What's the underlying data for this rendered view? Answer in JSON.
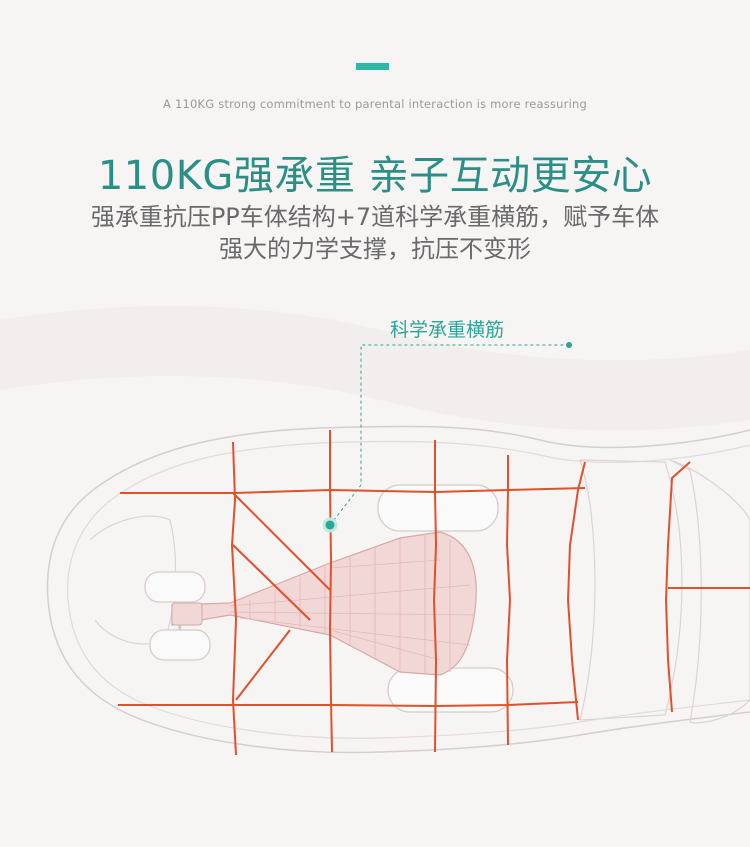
{
  "header": {
    "subtitle_en": "A 110KG strong commitment to parental interaction is more reassuring",
    "headline": "110KG强承重 亲子互动更安心",
    "description_line1": "强承重抗压PP车体结构+7道科学承重横筋，赋予车体",
    "description_line2": "强大的力学支撑，抗压不变形"
  },
  "callout": {
    "label": "科学承重横筋"
  },
  "colors": {
    "accent": "#2fb8a6",
    "headline": "#2a8f87",
    "rib": "#e2502a",
    "outline": "#d9cfcf",
    "background": "#f7f4f4"
  }
}
